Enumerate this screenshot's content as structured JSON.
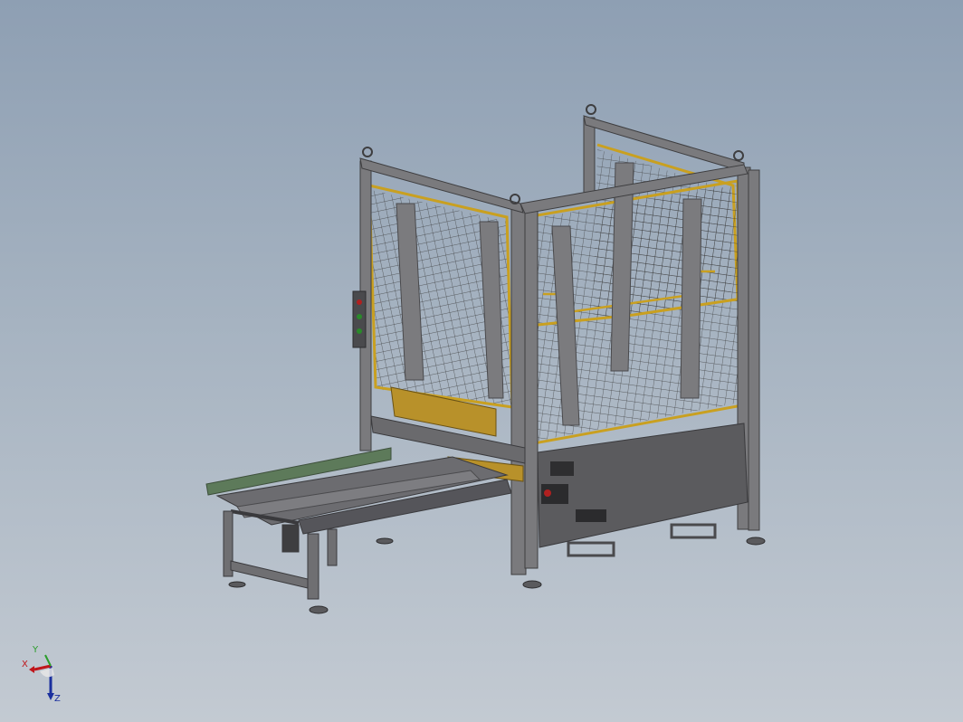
{
  "viewport": {
    "background_top": "#8e9fb3",
    "background_bottom": "#c3cad2"
  },
  "model": {
    "frame_color": "#6f6f72",
    "guard_color": "#c9a020",
    "mesh_color": "#3a3a3a",
    "panel_color": "#5b5b5e",
    "conveyor_belt_color": "#5d7a5a",
    "cylinder_color": "#b8912a"
  },
  "triad": {
    "x_label": "X",
    "y_label": "Y",
    "z_label": "Z",
    "x_color": "#c0161b",
    "y_color": "#2a9d2a",
    "z_color": "#1a2f9e"
  }
}
